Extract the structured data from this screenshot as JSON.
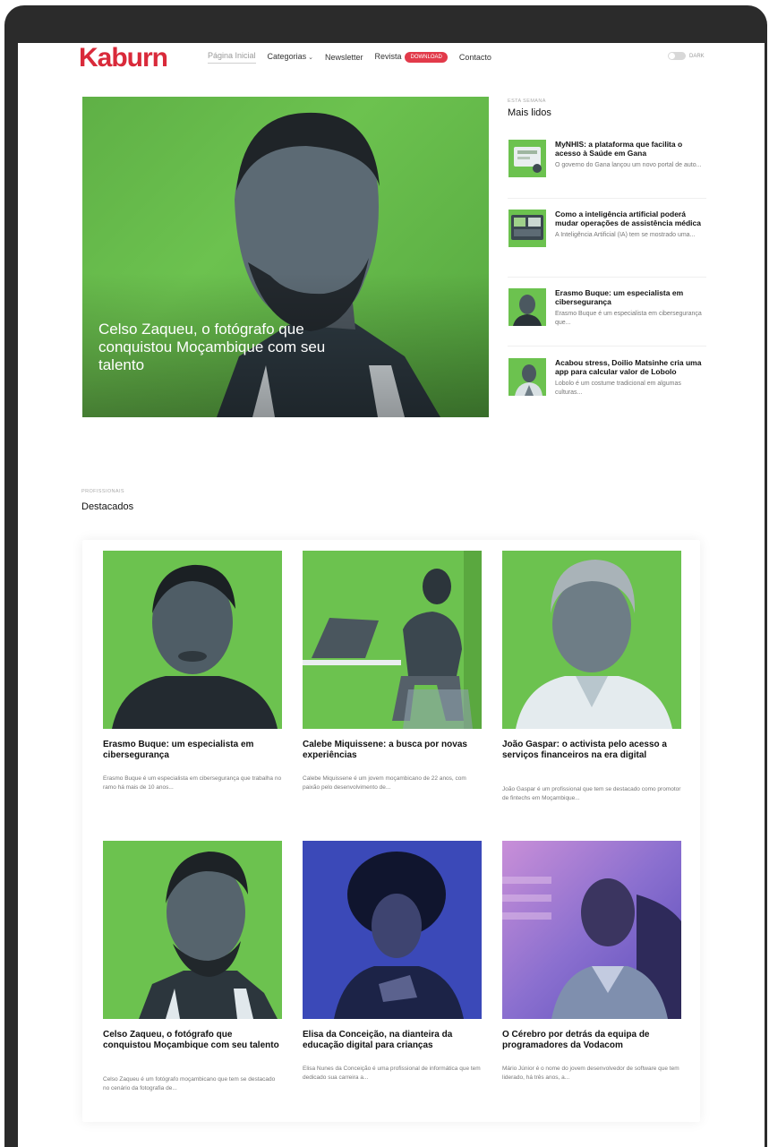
{
  "header": {
    "logo": "Kaburn",
    "nav": [
      {
        "label": "Página Inicial"
      },
      {
        "label": "Categorias"
      },
      {
        "label": "Newsletter"
      },
      {
        "label": "Revista"
      },
      {
        "label": "Contacto"
      }
    ],
    "download_badge": "DOWNLOAD",
    "toggle_label": "DARK"
  },
  "hero": {
    "title": "Celso Zaqueu, o fotógrafo que conquistou Moçambique com seu talento"
  },
  "most_read": {
    "kicker": "ESTA SEMANA",
    "title": "Mais lidos",
    "items": [
      {
        "headline": "MyNHIS: a plataforma que facilita o acesso à Saúde em Gana",
        "excerpt": "O governo do Gana lançou um novo portal de auto..."
      },
      {
        "headline": "Como a inteligência artificial poderá mudar operações de assistência médica",
        "excerpt": "A Inteligência Artificial (IA) tem se mostrado uma..."
      },
      {
        "headline": "Erasmo Buque: um especialista em cibersegurança",
        "excerpt": "Erasmo Buque é um especialista em cibersegurança que..."
      },
      {
        "headline": "Acabou stress, Doilio Matsinhe cria uma app para calcular valor de Lobolo",
        "excerpt": "Lobolo é um costume tradicional em algumas culturas..."
      }
    ]
  },
  "featured": {
    "kicker": "PROFISSIONAIS",
    "title": "Destacados",
    "cards": [
      {
        "title": "Erasmo Buque: um especialista em cibersegurança",
        "excerpt": "Erasmo Buque é um especialista em cibersegurança que trabalha no ramo há mais de 10 anos..."
      },
      {
        "title": "Calebe Miquissene: a busca por novas experiências",
        "excerpt": "Calebe Miquissene é um jovem moçambicano de 22 anos, com paixão pelo desenvolvimento de..."
      },
      {
        "title": "João Gaspar: o activista pelo acesso a serviços financeiros na era digital",
        "excerpt": "João Gaspar é um profissional que tem se destacado como promotor de fintechs em Moçambique..."
      },
      {
        "title": "Celso Zaqueu, o fotógrafo que conquistou Moçambique com seu talento",
        "excerpt": "Celso Zaqueu é um fotógrafo moçambicano que tem se destacado no cenário da fotografia de..."
      },
      {
        "title": "Elisa da Conceição, na dianteira da educação digital para crianças",
        "excerpt": "Elisa Nunes da Conceição é uma profissional de informática que tem dedicado sua carreira a..."
      },
      {
        "title": "O Cérebro por detrás da equipa de programadores da Vodacom",
        "excerpt": "Mário Júnior é o nome do jovem desenvolvedor de software que tem liderado, há três anos, a..."
      }
    ]
  },
  "colors": {
    "brand": "#d92a3a",
    "accent_green": "#6cc24f",
    "accent_blue": "#3b49b8"
  }
}
